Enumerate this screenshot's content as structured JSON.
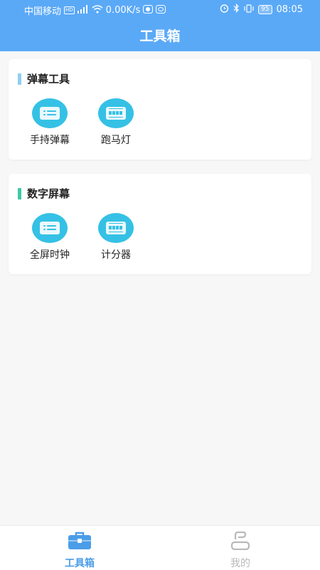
{
  "status_bar": {
    "carrier": "中国移动",
    "hd_badge": "HD",
    "network_speed": "0.00K/s",
    "battery": "95",
    "time": "08:05"
  },
  "header": {
    "title": "工具箱"
  },
  "sections": [
    {
      "title": "弹幕工具",
      "accent_color": "#8ecfee",
      "items": [
        {
          "label": "手持弹幕",
          "icon": "list-icon"
        },
        {
          "label": "跑马灯",
          "icon": "marquee-icon"
        }
      ]
    },
    {
      "title": "数字屏幕",
      "accent_color": "#3ec9a7",
      "items": [
        {
          "label": "全屏时钟",
          "icon": "list-icon"
        },
        {
          "label": "计分器",
          "icon": "marquee-icon"
        }
      ]
    }
  ],
  "bottom_nav": {
    "items": [
      {
        "label": "工具箱",
        "icon": "toolbox-icon",
        "active": true
      },
      {
        "label": "我的",
        "icon": "profile-icon",
        "active": false
      }
    ]
  },
  "colors": {
    "primary": "#5aa9f7",
    "tool_icon": "#35c1e5",
    "nav_active": "#4b9de8",
    "nav_inactive": "#b9b9b9"
  }
}
